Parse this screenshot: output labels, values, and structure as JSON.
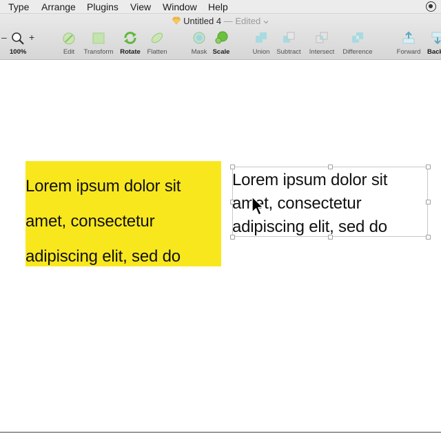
{
  "menubar": {
    "items": [
      "Type",
      "Arrange",
      "Plugins",
      "View",
      "Window",
      "Help"
    ]
  },
  "document": {
    "title": "Untitled 4",
    "separator": "—",
    "status": "Edited"
  },
  "toolbar": {
    "zoom_minus": "–",
    "zoom_plus": "+",
    "zoom_level": "100%",
    "tools": [
      {
        "label": "Edit",
        "icon": "edit-icon"
      },
      {
        "label": "Transform",
        "icon": "transform-icon"
      },
      {
        "label": "Rotate",
        "icon": "rotate-icon"
      },
      {
        "label": "Flatten",
        "icon": "flatten-icon"
      },
      {
        "label": "Mask",
        "icon": "mask-icon"
      },
      {
        "label": "Scale",
        "icon": "scale-icon"
      },
      {
        "label": "Union",
        "icon": "union-icon"
      },
      {
        "label": "Subtract",
        "icon": "subtract-icon"
      },
      {
        "label": "Intersect",
        "icon": "intersect-icon"
      },
      {
        "label": "Difference",
        "icon": "difference-icon"
      },
      {
        "label": "Forward",
        "icon": "forward-icon"
      },
      {
        "label": "Back",
        "icon": "backward-icon"
      }
    ]
  },
  "canvas": {
    "left_text": {
      "line1": "Lorem ipsum dolor sit",
      "line2": "amet, consectetur",
      "line3": "adipiscing elit, sed do",
      "background": "#f9e71e"
    },
    "right_text": {
      "line1": "Lorem ipsum dolor sit",
      "line2": "amet, consectetur",
      "line3": "adipiscing elit, sed do"
    }
  },
  "colors": {
    "toolbar_bg": "#dedede",
    "highlight": "#f9e71e",
    "icon_green": "#7cc84e"
  }
}
